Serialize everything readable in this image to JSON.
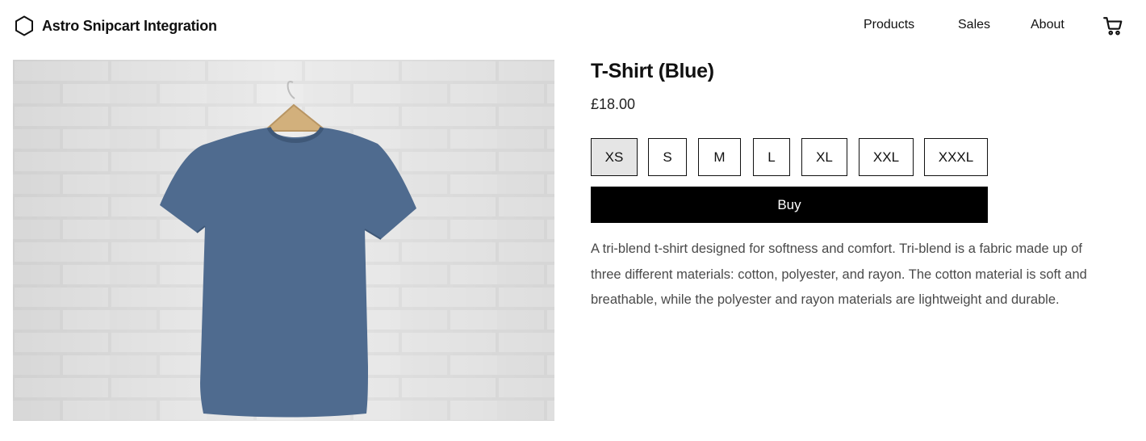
{
  "header": {
    "brand_icon": "hexagon-icon",
    "brand_name": "Astro Snipcart Integration",
    "nav": [
      {
        "label": "Products"
      },
      {
        "label": "Sales"
      },
      {
        "label": "About"
      }
    ],
    "cart_icon": "shopping-cart-icon"
  },
  "product": {
    "image_alt": "T-Shirt (Blue)",
    "shirt_color": "#4f6b8f",
    "title": "T-Shirt (Blue)",
    "price": "£18.00",
    "sizes": [
      {
        "label": "XS",
        "selected": true
      },
      {
        "label": "S",
        "selected": false
      },
      {
        "label": "M",
        "selected": false
      },
      {
        "label": "L",
        "selected": false
      },
      {
        "label": "XL",
        "selected": false
      },
      {
        "label": "XXL",
        "selected": false
      },
      {
        "label": "XXXL",
        "selected": false
      }
    ],
    "buy_label": "Buy",
    "description": "A tri-blend t-shirt designed for softness and comfort. Tri-blend is a fabric made up of three different materials: cotton, polyester, and rayon. The cotton material is soft and breathable, while the polyester and rayon materials are lightweight and durable."
  }
}
